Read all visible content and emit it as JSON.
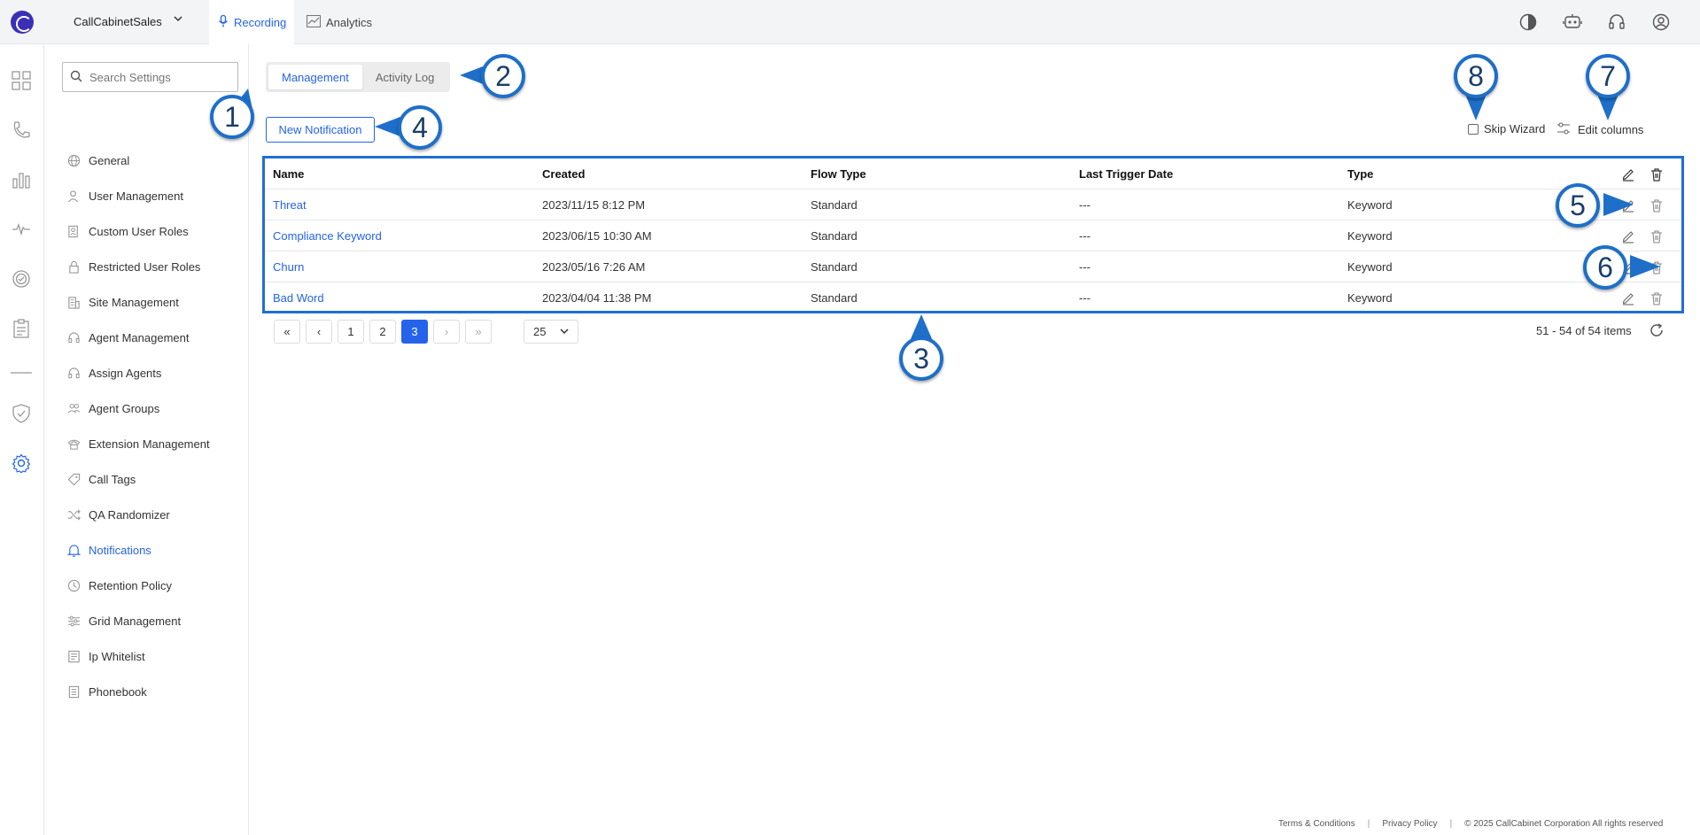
{
  "topbar": {
    "workspace": "CallCabinetSales",
    "nav": [
      {
        "label": "Recording",
        "active": true
      },
      {
        "label": "Analytics",
        "active": false
      }
    ]
  },
  "sidebar": {
    "search_placeholder": "Search Settings",
    "items": [
      {
        "label": "General",
        "icon": "globe-icon"
      },
      {
        "label": "User Management",
        "icon": "user-icon"
      },
      {
        "label": "Custom User Roles",
        "icon": "user-badge-icon"
      },
      {
        "label": "Restricted User Roles",
        "icon": "lock-icon"
      },
      {
        "label": "Site Management",
        "icon": "building-icon"
      },
      {
        "label": "Agent Management",
        "icon": "headset-icon"
      },
      {
        "label": "Assign Agents",
        "icon": "headset-icon"
      },
      {
        "label": "Agent Groups",
        "icon": "group-icon"
      },
      {
        "label": "Extension Management",
        "icon": "phone-icon"
      },
      {
        "label": "Call Tags",
        "icon": "tag-icon"
      },
      {
        "label": "QA Randomizer",
        "icon": "shuffle-icon"
      },
      {
        "label": "Notifications",
        "icon": "bell-icon",
        "active": true
      },
      {
        "label": "Retention Policy",
        "icon": "clock-icon"
      },
      {
        "label": "Grid Management",
        "icon": "sliders-icon"
      },
      {
        "label": "Ip Whitelist",
        "icon": "list-icon"
      },
      {
        "label": "Phonebook",
        "icon": "book-icon"
      }
    ]
  },
  "main": {
    "tabs": [
      {
        "label": "Management",
        "active": true
      },
      {
        "label": "Activity Log",
        "active": false
      }
    ],
    "new_button": "New Notification",
    "skip_wizard": "Skip Wizard",
    "edit_columns": "Edit columns",
    "columns": [
      "Name",
      "Created",
      "Flow Type",
      "Last Trigger Date",
      "Type"
    ],
    "rows": [
      {
        "name": "Threat",
        "created": "2023/11/15 8:12 PM",
        "flow": "Standard",
        "last": "---",
        "type": "Keyword"
      },
      {
        "name": "Compliance Keyword",
        "created": "2023/06/15 10:30 AM",
        "flow": "Standard",
        "last": "---",
        "type": "Keyword"
      },
      {
        "name": "Churn",
        "created": "2023/05/16 7:26 AM",
        "flow": "Standard",
        "last": "---",
        "type": "Keyword"
      },
      {
        "name": "Bad Word",
        "created": "2023/04/04 11:38 PM",
        "flow": "Standard",
        "last": "---",
        "type": "Keyword"
      }
    ],
    "pager": {
      "first": "«",
      "prev": "‹",
      "pages": [
        "1",
        "2",
        "3"
      ],
      "current": "3",
      "next": "›",
      "last": "»",
      "page_size": "25",
      "range": "51 - 54 of 54 items"
    }
  },
  "footer": {
    "terms": "Terms & Conditions",
    "privacy": "Privacy Policy",
    "copyright": "© 2025 CallCabinet Corporation All rights reserved"
  },
  "callouts": [
    "1",
    "2",
    "3",
    "4",
    "5",
    "6",
    "7",
    "8"
  ],
  "colors": {
    "accent": "#2563eb",
    "callout_border": "#1e6fc9"
  }
}
